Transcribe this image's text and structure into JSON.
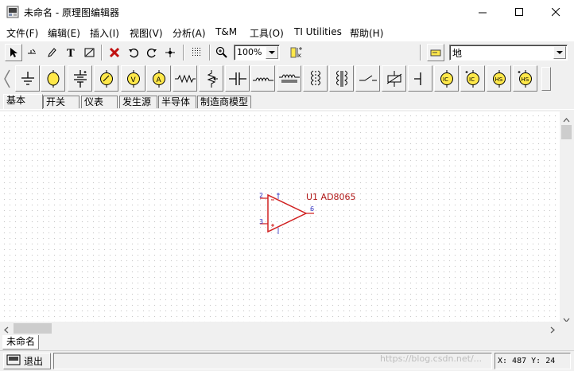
{
  "window": {
    "title": "未命名 - 原理图编辑器",
    "icon": "app-schematic-icon",
    "controls": [
      "minimize-icon",
      "maximize-icon",
      "close-icon"
    ]
  },
  "menu": [
    "文件(F)",
    "编辑(E)",
    "插入(I)",
    "视图(V)",
    "分析(A)",
    "T&M",
    "工具(O)",
    "TI Utilities",
    "帮助(H)"
  ],
  "toolbar": {
    "buttons": [
      "pointer-icon",
      "wire-icon",
      "pen-icon",
      "text-icon",
      "no-connect-icon",
      "delete-icon",
      "undo-icon",
      "redo-icon",
      "junction-icon",
      "grid-icon",
      "zoom-icon"
    ],
    "zoom_value": "100%",
    "right_icon": "probe-icon",
    "component_value": "地"
  },
  "palette": {
    "items": [
      "ground-icon",
      "lamp-icon",
      "battery-icon",
      "voltmeter-icon",
      "current-meter-icon",
      "ammeter-icon",
      "resistor-icon",
      "potentiometer-icon",
      "capacitor-icon",
      "inductor-icon",
      "core-inductor-icon",
      "transformer-icon",
      "core-transformer-icon",
      "switch-icon",
      "varistor-icon",
      "node-icon",
      "ic-source-icon",
      "ic-source-alt-icon",
      "hs-source-icon",
      "hs-source-alt-icon"
    ]
  },
  "tabs": [
    "基本",
    "开关",
    "仪表",
    "发生源",
    "半导体",
    "制造商模型"
  ],
  "active_tab": "基本",
  "schematic": {
    "reference": "U1 AD8065",
    "pins": [
      "2",
      "3",
      "6"
    ],
    "color": "#d02020"
  },
  "doc_tab": "未命名",
  "status": {
    "exit_label": "退出",
    "message": "",
    "coords": "X: 487  Y: 24"
  },
  "watermark": "https://blog.csdn.net/...",
  "colors": {
    "accent": "#d02020",
    "pin": "#3030c0",
    "background": "#f0f0f0"
  }
}
